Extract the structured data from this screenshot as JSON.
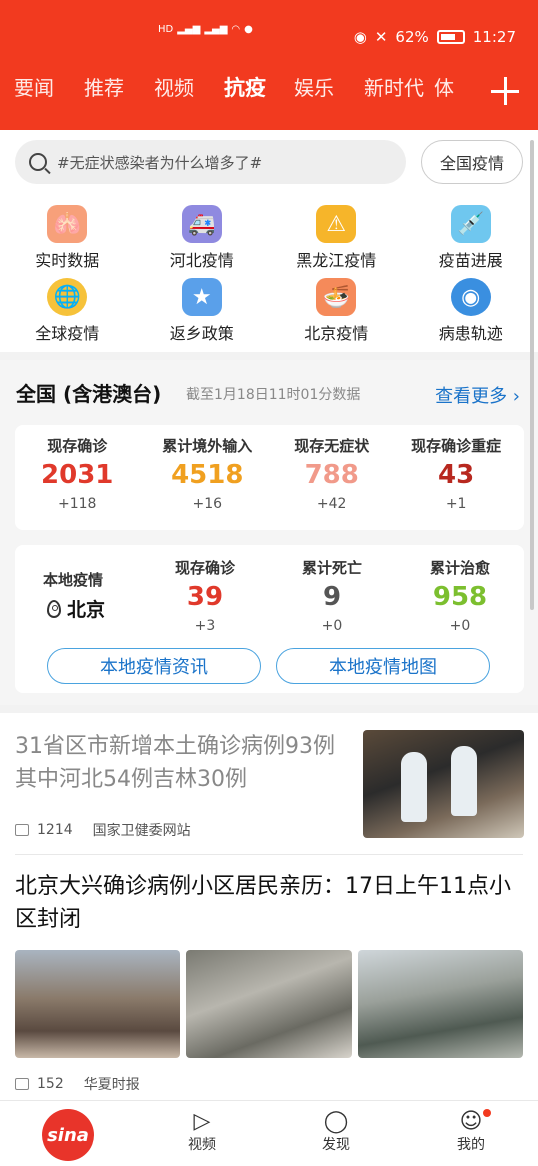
{
  "status_bar": {
    "signal_label": "HD",
    "battery": "62%",
    "time": "11:27"
  },
  "tabs": [
    {
      "label": "要闻"
    },
    {
      "label": "推荐"
    },
    {
      "label": "视频"
    },
    {
      "label": "抗疫"
    },
    {
      "label": "娱乐"
    },
    {
      "label": "新时代"
    },
    {
      "label": "体"
    }
  ],
  "active_tab": "抗疫",
  "search": {
    "placeholder": "#无症状感染者为什么增多了#",
    "nation_button": "全国疫情"
  },
  "quick_links": [
    {
      "label": "实时数据",
      "icon": "lungs-icon"
    },
    {
      "label": "河北疫情",
      "icon": "ambulance-icon"
    },
    {
      "label": "黑龙江疫情",
      "icon": "warning-icon"
    },
    {
      "label": "疫苗进展",
      "icon": "syringe-icon"
    },
    {
      "label": "全球疫情",
      "icon": "globe-icon"
    },
    {
      "label": "返乡政策",
      "icon": "policy-search-icon"
    },
    {
      "label": "北京疫情",
      "icon": "noodle-bowl-icon"
    },
    {
      "label": "病患轨迹",
      "icon": "location-track-icon"
    }
  ],
  "national": {
    "title": "全国 (含港澳台)",
    "subtitle": "截至1月18日11时01分数据",
    "more": "查看更多 ›",
    "stats": [
      {
        "label": "现存确诊",
        "value": "2031",
        "delta": "+118",
        "color": "#e0392b"
      },
      {
        "label": "累计境外输入",
        "value": "4518",
        "delta": "+16",
        "color": "#f0a020"
      },
      {
        "label": "现存无症状",
        "value": "788",
        "delta": "+42",
        "color": "#f19a8a"
      },
      {
        "label": "现存确诊重症",
        "value": "43",
        "delta": "+1",
        "color": "#b8281f"
      }
    ]
  },
  "local": {
    "name": "本地疫情",
    "city": "北京",
    "stats": [
      {
        "label": "现存确诊",
        "value": "39",
        "delta": "+3",
        "color": "#e0392b"
      },
      {
        "label": "累计死亡",
        "value": "9",
        "delta": "+0",
        "color": "#555555"
      },
      {
        "label": "累计治愈",
        "value": "958",
        "delta": "+0",
        "color": "#7cbf2f"
      }
    ],
    "info_button": "本地疫情资讯",
    "map_button": "本地疫情地图"
  },
  "news": [
    {
      "title": "31省区市新增本土确诊病例93例 其中河北54例吉林30例",
      "comments": "1214",
      "source": "国家卫健委网站"
    },
    {
      "title": "北京大兴确诊病例小区居民亲历：17日上午11点小区封闭",
      "comments": "152",
      "source": "华夏时报"
    }
  ],
  "bottom_nav": [
    {
      "label": "",
      "icon": "sina-logo-icon"
    },
    {
      "label": "视频",
      "icon": "video-icon"
    },
    {
      "label": "发现",
      "icon": "planet-icon"
    },
    {
      "label": "我的",
      "icon": "user-icon"
    }
  ],
  "colors": {
    "brand": "#f23a1f",
    "link": "#1a73c9"
  }
}
